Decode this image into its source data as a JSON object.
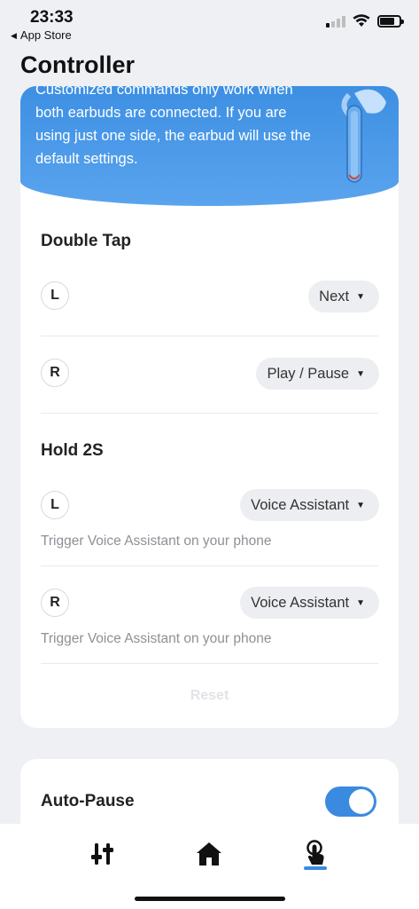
{
  "status_bar": {
    "time": "23:33",
    "back_app": "App Store",
    "back_glyph": "◀"
  },
  "page_title": "Controller",
  "banner": {
    "text": "Customized commands only work when both earbuds are connected. If you are using just one side, the earbud will use the default settings."
  },
  "double_tap": {
    "title": "Double Tap",
    "left": {
      "side": "L",
      "action": "Next"
    },
    "right": {
      "side": "R",
      "action": "Play / Pause"
    }
  },
  "hold": {
    "title": "Hold 2S",
    "left": {
      "side": "L",
      "action": "Voice Assistant",
      "hint": "Trigger Voice Assistant on your phone"
    },
    "right": {
      "side": "R",
      "action": "Voice Assistant",
      "hint": "Trigger Voice Assistant on your phone"
    }
  },
  "reset_label": "Reset",
  "auto_pause": {
    "label": "Auto-Pause",
    "enabled": true
  },
  "caret_glyph": "▼",
  "tabs": [
    {
      "icon": "equalizer-sliders-icon",
      "active": false
    },
    {
      "icon": "home-icon",
      "active": false
    },
    {
      "icon": "touch-control-icon",
      "active": true
    }
  ],
  "colors": {
    "accent": "#3a8be0",
    "banner": "#4a98e8",
    "background": "#eef0f4"
  }
}
